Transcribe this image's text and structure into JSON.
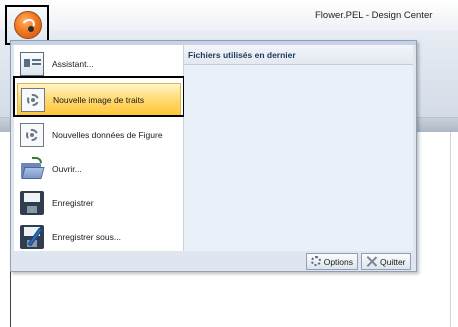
{
  "window": {
    "title": "Flower.PEL - Design Center"
  },
  "menu": {
    "items": [
      {
        "label": "Assistant...",
        "icon": "assistant-icon",
        "selected": false
      },
      {
        "label": "Nouvelle image de traits",
        "icon": "new-line-image-icon",
        "selected": true
      },
      {
        "label": "Nouvelles données de Figure",
        "icon": "new-figure-data-icon",
        "selected": false
      },
      {
        "label": "Ouvrir...",
        "icon": "open-folder-icon",
        "selected": false
      },
      {
        "label": "Enregistrer",
        "icon": "save-disk-icon",
        "selected": false
      },
      {
        "label": "Enregistrer sous...",
        "icon": "save-as-icon",
        "selected": false
      }
    ],
    "recent_files_title": "Fichiers utilisés en dernier",
    "options_label": "Options",
    "quit_label": "Quitter"
  },
  "colors": {
    "highlight": "#ffd86b",
    "accent_orb": "#f27a20"
  }
}
